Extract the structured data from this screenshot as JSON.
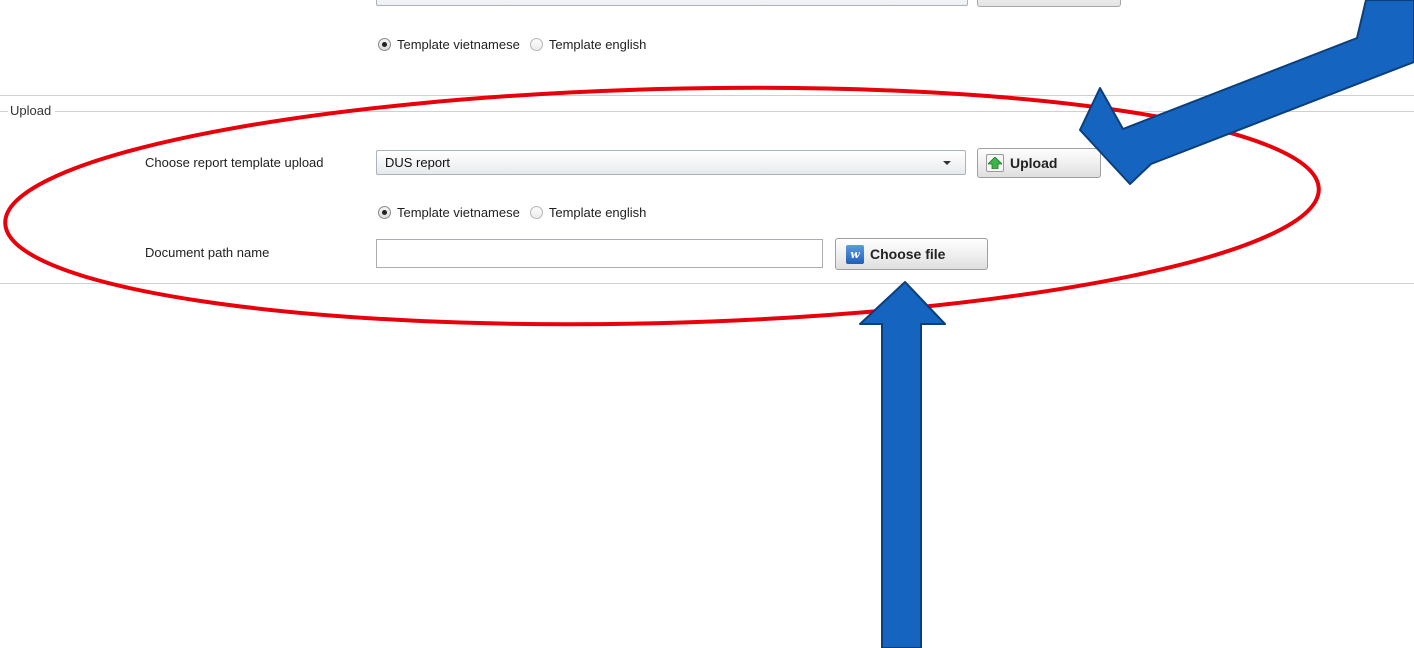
{
  "download": {
    "radio_vietnamese": "Template vietnamese",
    "radio_english": "Template english",
    "selected": "vietnamese"
  },
  "upload": {
    "group_title": "Upload",
    "template_label": "Choose report template upload",
    "template_value": "DUS report",
    "upload_button": "Upload",
    "radio_vietnamese": "Template vietnamese",
    "radio_english": "Template english",
    "selected": "vietnamese",
    "path_label": "Document path name",
    "path_value": "",
    "choose_button": "Choose file",
    "word_icon_glyph": "w"
  },
  "icons": {
    "combo_arrow": "chevron-down-icon",
    "upload": "upload-arrow-icon",
    "choose_file": "word-document-icon"
  },
  "colors": {
    "annotation_ellipse": "#e8000b",
    "annotation_arrow": "#1565c0",
    "annotation_arrow_outline": "#0c3f7a",
    "upload_icon_green": "#3bb54a"
  }
}
